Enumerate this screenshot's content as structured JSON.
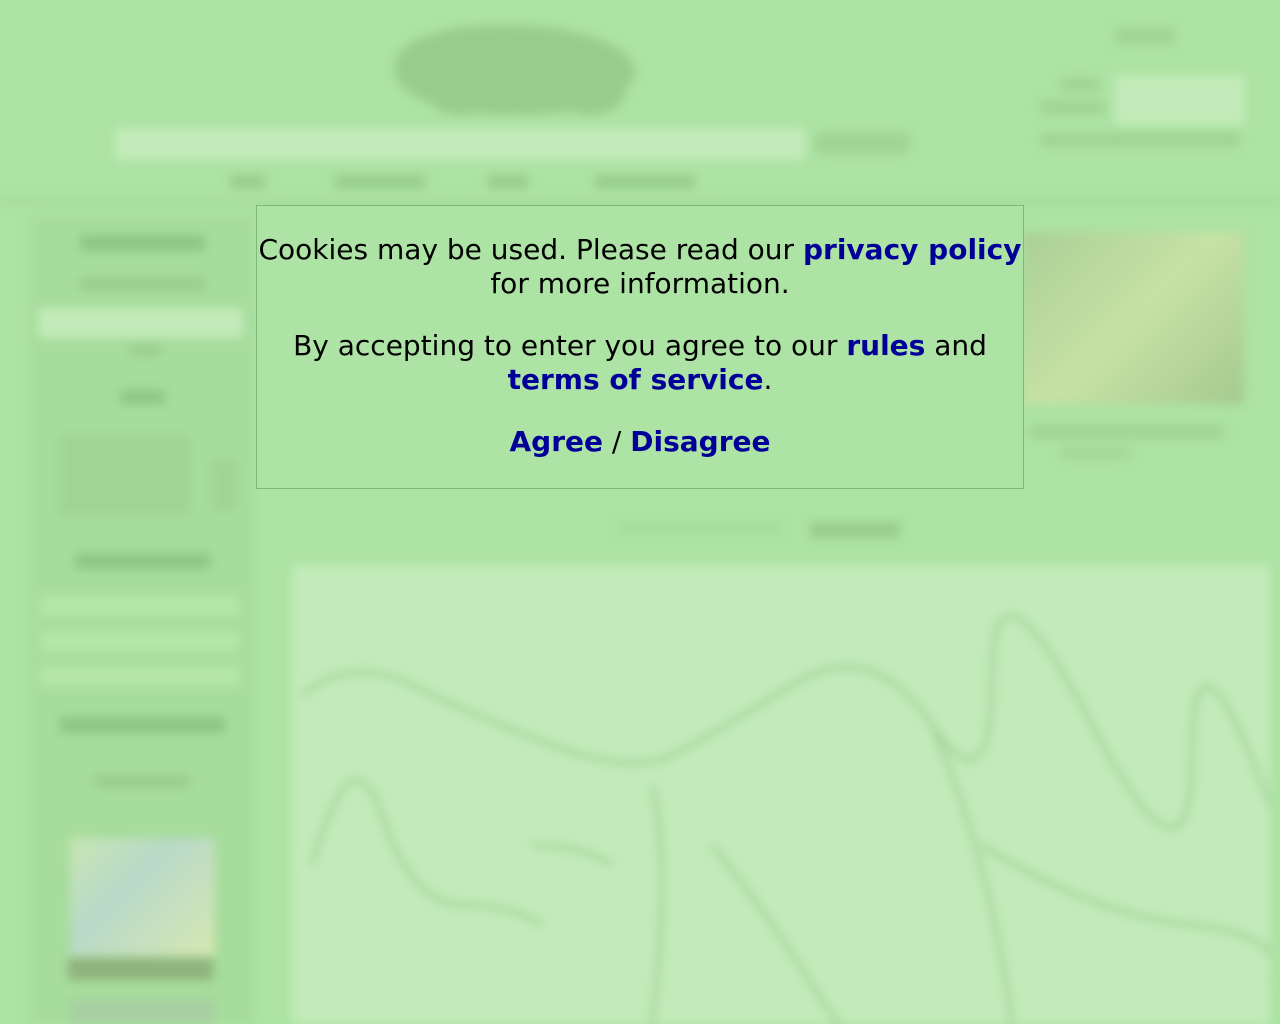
{
  "modal": {
    "line1_prefix": "Cookies may be used. Please read our",
    "privacy_link": "privacy policy",
    "line1_suffix": "for more information.",
    "line2_prefix": "By accepting to enter you agree to our",
    "rules_link": "rules",
    "and_text": "and",
    "terms_link": "terms of service",
    "period": ".",
    "agree_label": "Agree",
    "separator": "/",
    "disagree_label": "Disagree"
  },
  "colors": {
    "background": "#ade3a4",
    "link": "#000099",
    "modal_border": "#7fb87a"
  }
}
